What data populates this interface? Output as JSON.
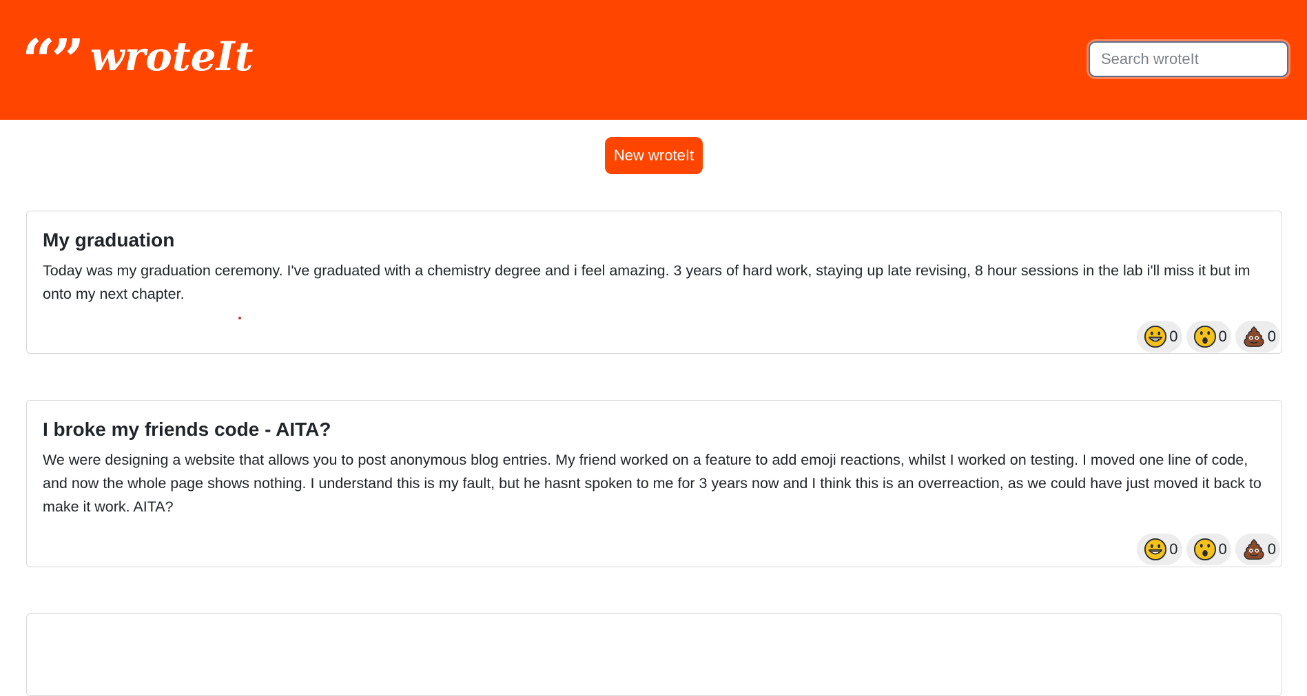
{
  "header": {
    "logo_quote": "“”",
    "logo_text": "wroteIt",
    "search_placeholder": "Search wroteIt",
    "search_value": ""
  },
  "actions": {
    "new_label": "New wroteIt"
  },
  "colors": {
    "brand": "#ff4500",
    "reaction_bg": "#ededed"
  },
  "posts": [
    {
      "title": "My graduation",
      "body": "Today was my graduation ceremony. I've graduated with a chemistry degree and i feel amazing. 3 years of hard work, staying up late revising, 8 hour sessions in the lab i'll miss it but im onto my next chapter.",
      "reactions": [
        {
          "icon": "grinning-face-icon",
          "count": "0"
        },
        {
          "icon": "surprised-face-icon",
          "count": "0"
        },
        {
          "icon": "poop-icon",
          "count": "0"
        }
      ]
    },
    {
      "title": "I broke my friends code - AITA?",
      "body": "We were designing a website that allows you to post anonymous blog entries. My friend worked on a feature to add emoji reactions, whilst I worked on testing. I moved one line of code, and now the whole page shows nothing. I understand this is my fault, but he hasnt spoken to me for 3 years now and I think this is an overreaction, as we could have just moved it back to make it work. AITA?",
      "reactions": [
        {
          "icon": "grinning-face-icon",
          "count": "0"
        },
        {
          "icon": "surprised-face-icon",
          "count": "0"
        },
        {
          "icon": "poop-icon",
          "count": "0"
        }
      ]
    }
  ]
}
